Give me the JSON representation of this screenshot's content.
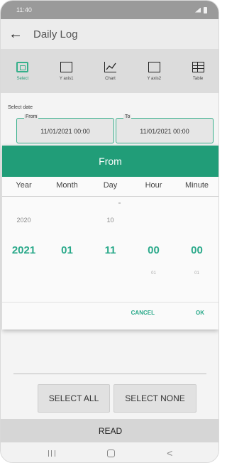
{
  "status": {
    "time": "11:40"
  },
  "appbar": {
    "title": "Daily Log"
  },
  "tabs": [
    {
      "label": "Select",
      "icon": "select-icon",
      "active": true
    },
    {
      "label": "Y axis1",
      "icon": "box-icon",
      "active": false
    },
    {
      "label": "Chart",
      "icon": "chart-icon",
      "active": false
    },
    {
      "label": "Y axis2",
      "icon": "box-icon",
      "active": false
    },
    {
      "label": "Table",
      "icon": "table-icon",
      "active": false
    }
  ],
  "select_date": {
    "label": "Select date",
    "from_caption": "From",
    "from_value": "11/01/2021 00:00",
    "to_caption": "To",
    "to_value": "11/01/2021 00:00"
  },
  "picker": {
    "title": "From",
    "columns": [
      "Year",
      "Month",
      "Day",
      "Hour",
      "Minute"
    ],
    "prev": [
      "2020",
      "",
      "10",
      "",
      ""
    ],
    "selected": [
      "2021",
      "01",
      "11",
      "00",
      "00"
    ],
    "next": [
      "",
      "",
      "",
      "01",
      "01"
    ],
    "cancel_label": "CANCEL",
    "ok_label": "OK"
  },
  "actions": {
    "select_all": "SELECT ALL",
    "select_none": "SELECT NONE",
    "read": "READ"
  },
  "colors": {
    "accent": "#219d78",
    "accent_text": "#2aa98a"
  }
}
